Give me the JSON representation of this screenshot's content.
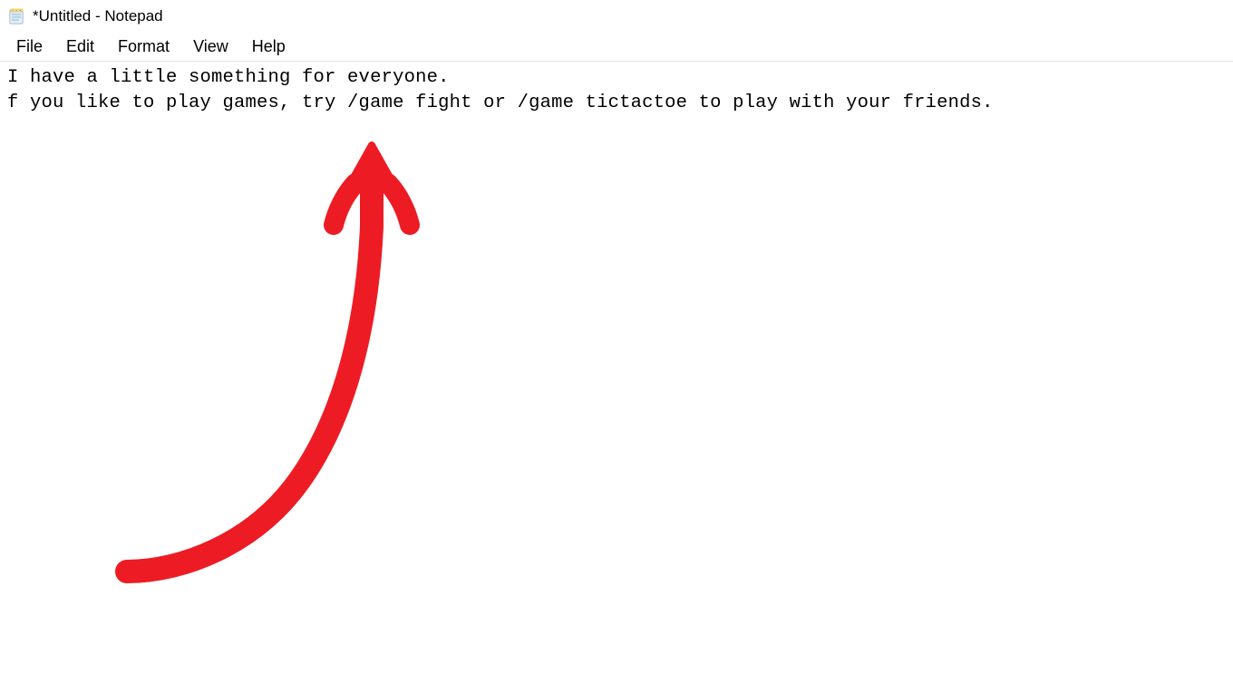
{
  "titlebar": {
    "title": "*Untitled - Notepad"
  },
  "menubar": {
    "items": [
      {
        "label": "File"
      },
      {
        "label": "Edit"
      },
      {
        "label": "Format"
      },
      {
        "label": "View"
      },
      {
        "label": "Help"
      }
    ]
  },
  "editor": {
    "content": "I have a little something for everyone.\nf you like to play games, try /game fight or /game tictactoe to play with your friends."
  },
  "annotation": {
    "type": "arrow",
    "color": "#ed1c24",
    "description": "hand-drawn-red-curved-arrow-pointing-up"
  }
}
